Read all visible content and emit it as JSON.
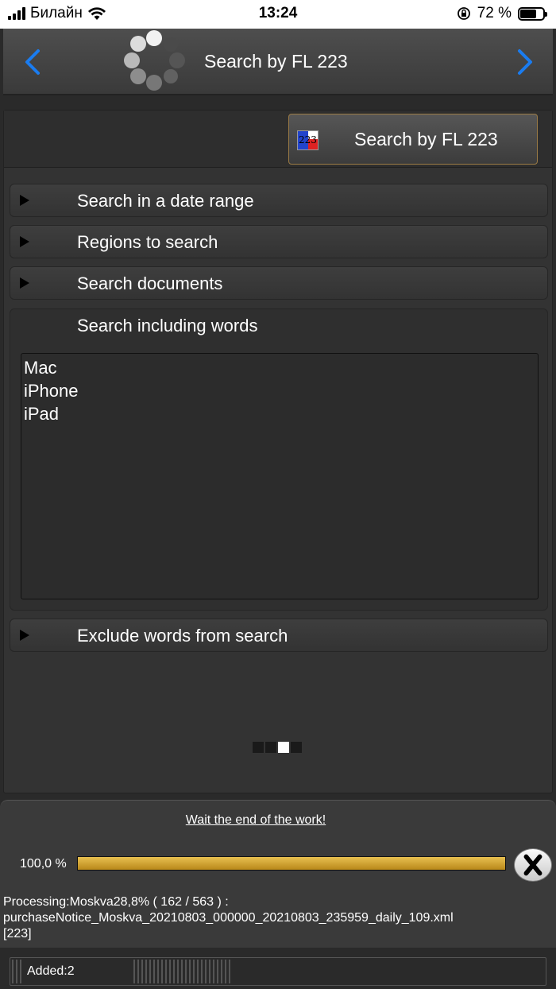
{
  "status_bar": {
    "carrier": "Билайн",
    "time": "13:24",
    "battery": "72 %",
    "battery_level": 0.72
  },
  "header": {
    "title": "Search by FL 223"
  },
  "toolbar": {
    "search_button_label": "Search by FL 223",
    "search_button_icon_text": "223"
  },
  "sections": {
    "date_range": "Search in a date range",
    "regions": "Regions to search",
    "documents": "Search documents",
    "including_words": "Search including words",
    "exclude_words": "Exclude words from search"
  },
  "including_words": [
    "Mac",
    "iPhone",
    "iPad"
  ],
  "pager": {
    "count": 4,
    "active": 3
  },
  "progress": {
    "wait_link": "Wait the end of the work!",
    "percent_text": "100,0 %",
    "value": 1.0,
    "processing_line1": "Processing:Moskva28,8%  (  162 / 563 )  :",
    "processing_line2": "purchaseNotice_Moskva_20210803_000000_20210803_235959_daily_109.xml",
    "processing_line3": "[223]"
  },
  "footer": {
    "added": "Added:2"
  },
  "colors": {
    "accent_blue": "#1a7cf0",
    "progress_gold": "#d4a535"
  }
}
